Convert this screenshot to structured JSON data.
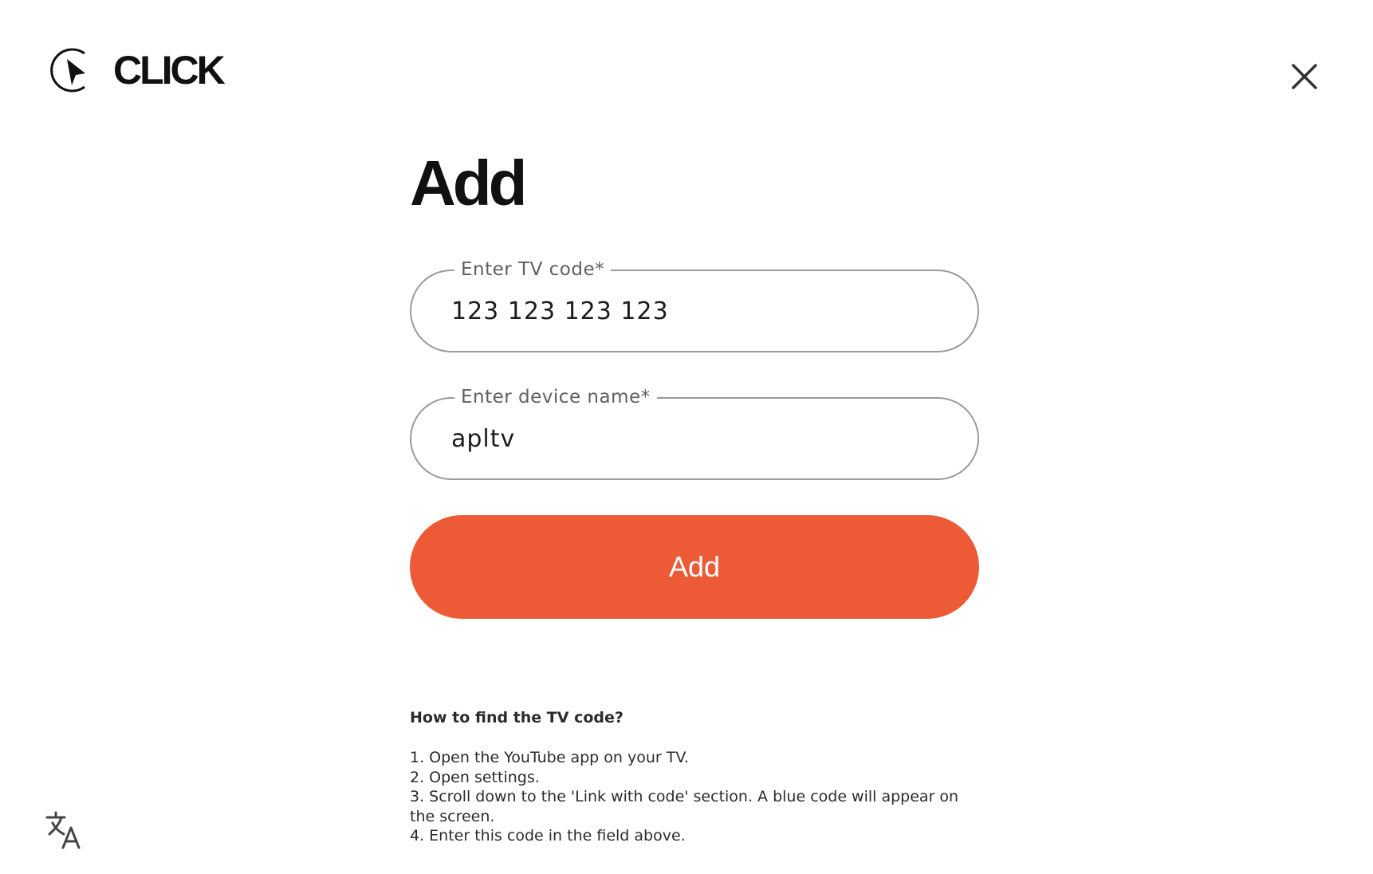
{
  "header": {
    "logo_text": "CLICK",
    "logo_icon": "play-cursor-icon",
    "close_icon": "close-icon"
  },
  "main": {
    "title": "Add",
    "tv_code_field": {
      "label": "Enter TV code*",
      "value": "123 123 123 123"
    },
    "device_name_field": {
      "label": "Enter device name*",
      "value": "apltv"
    },
    "add_button_label": "Add"
  },
  "help": {
    "title": "How to find the TV code?",
    "steps": [
      "1. Open the YouTube app on your TV.",
      "2. Open settings.",
      "3. Scroll down to the 'Link with code' section. A blue code will appear on the screen.",
      "4. Enter this code in the field above."
    ]
  },
  "footer": {
    "translate_icon": "translate-icon"
  },
  "colors": {
    "accent": "#ec5a36",
    "field_border": "#9a9a9a",
    "label": "#5f5f5f"
  }
}
